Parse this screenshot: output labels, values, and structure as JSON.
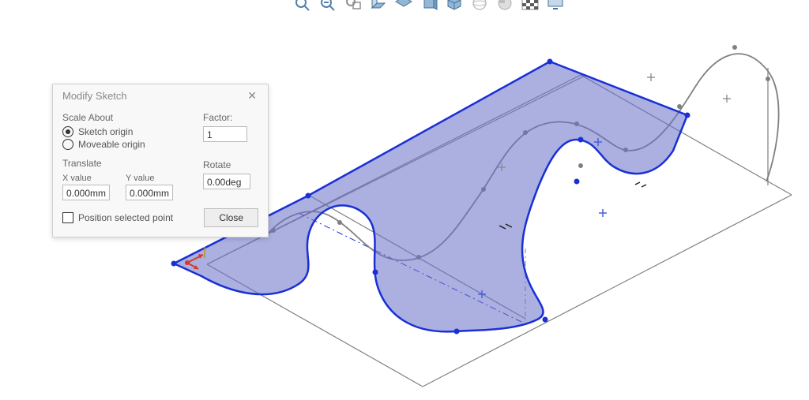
{
  "dialog": {
    "title": "Modify Sketch",
    "scaleAbout": {
      "label": "Scale About",
      "opt1": "Sketch origin",
      "opt2": "Moveable origin"
    },
    "factor": {
      "label": "Factor:",
      "value": "1"
    },
    "translate": {
      "label": "Translate",
      "xLabel": "X value",
      "yLabel": "Y value",
      "xValue": "0.000mm",
      "yValue": "0.000mm"
    },
    "rotate": {
      "label": "Rotate",
      "value": "0.00deg"
    },
    "positionSelected": "Position selected point",
    "closeLabel": "Close"
  },
  "colors": {
    "sketchFill": "#8a8ed9",
    "sketchStroke": "#1a2fd6",
    "wire": "#808080",
    "cross": "#4a5fd8",
    "axisRed": "#d43a2a"
  }
}
